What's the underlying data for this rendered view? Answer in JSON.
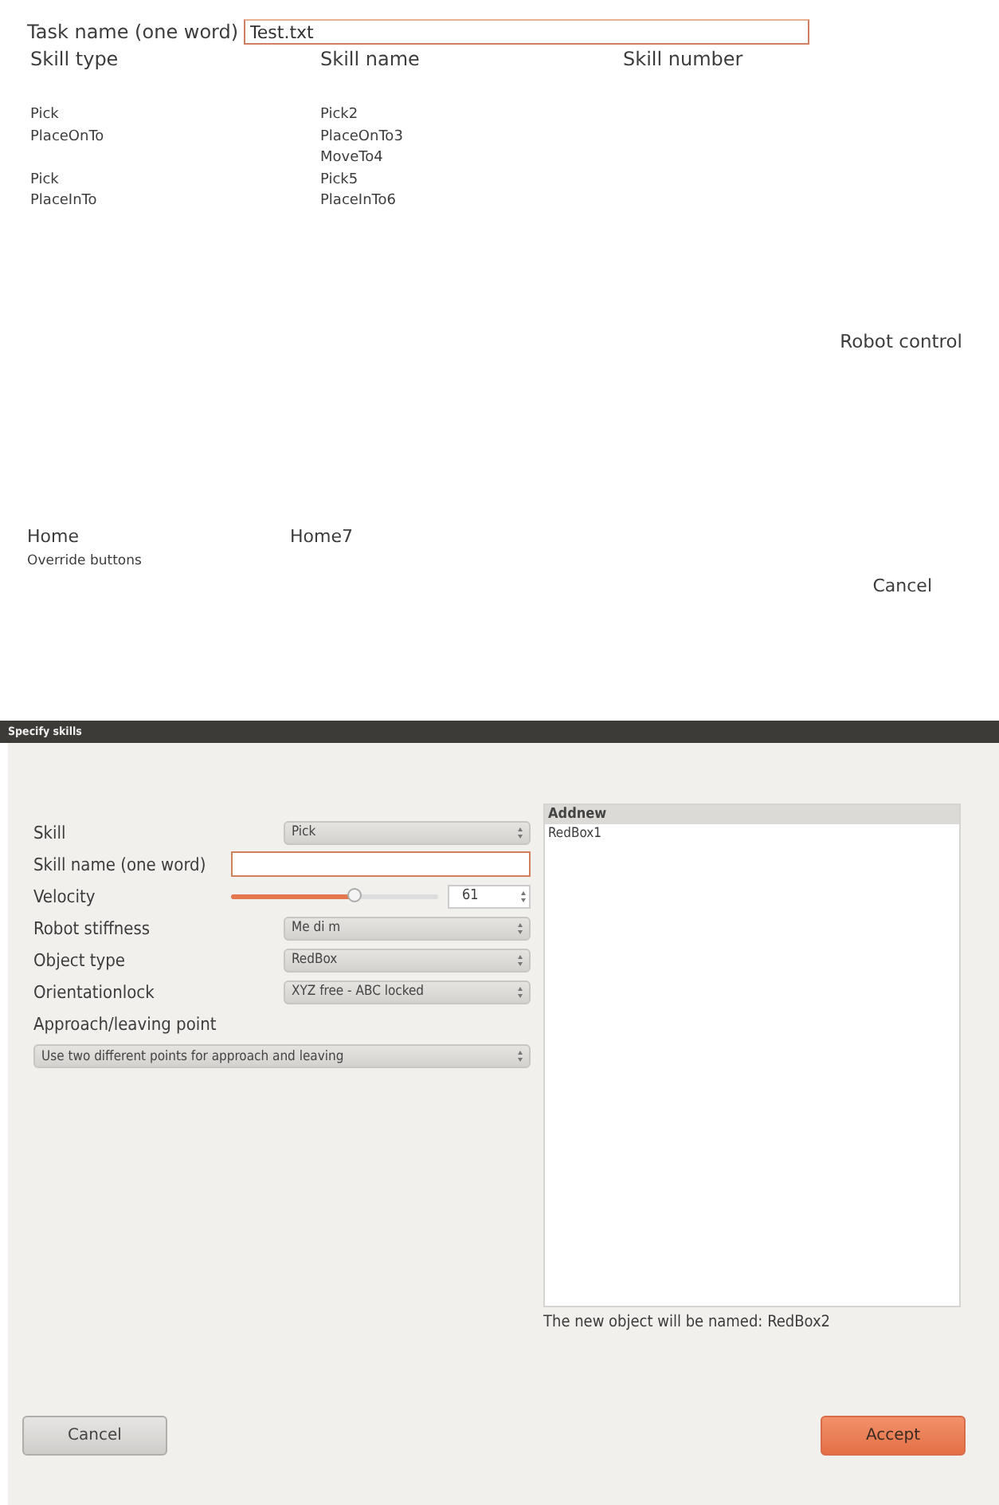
{
  "task_name": {
    "label": "Task name (one word)",
    "value": "Test.txt"
  },
  "table": {
    "columns": [
      "Skill type",
      "Skill name",
      "Skill number"
    ],
    "rows": [
      {
        "skill_type": "Pick",
        "skill_name": "Pick2"
      },
      {
        "skill_type": "PlaceOnTo",
        "skill_name": "PlaceOnTo3"
      },
      {
        "skill_name": "MoveTo4"
      },
      {
        "skill_type": "Pick",
        "skill_name": "Pick5"
      },
      {
        "skill_type": "PlaceInTo",
        "skill_name": "PlaceInTo6"
      }
    ]
  },
  "robot_control": "Robot control",
  "home": {
    "label": "Home",
    "value": "Home7"
  },
  "override_label": "Override buttons",
  "cancel": "Cancel",
  "dialog": {
    "title": "Specify skills",
    "fields": [
      {
        "kind": "combo",
        "label": "Skill",
        "value": "Pick"
      },
      {
        "kind": "text",
        "label": "Skill name (one word)"
      },
      {
        "kind": "slider",
        "label": "Velocity",
        "level": 0.61,
        "value": "61"
      },
      {
        "kind": "combo",
        "label": "Robot stiffness",
        "value": "Me di m"
      },
      {
        "kind": "combo",
        "label": "Object type",
        "value": "RedBox"
      },
      {
        "kind": "combo",
        "label": "Orientationlock",
        "value": "XYZ free - ABC locked"
      }
    ],
    "approach_label": "Approach/leaving point",
    "approach_value": "Use two different points for approach and leaving",
    "list_header": "Addnew",
    "list_items": [
      "RedBox1"
    ],
    "note": "The new object will be named: RedBox2",
    "buttons": [
      {
        "kind": "cancel",
        "label": "Cancel"
      },
      {
        "kind": "accept",
        "label": "Accept"
      }
    ]
  }
}
